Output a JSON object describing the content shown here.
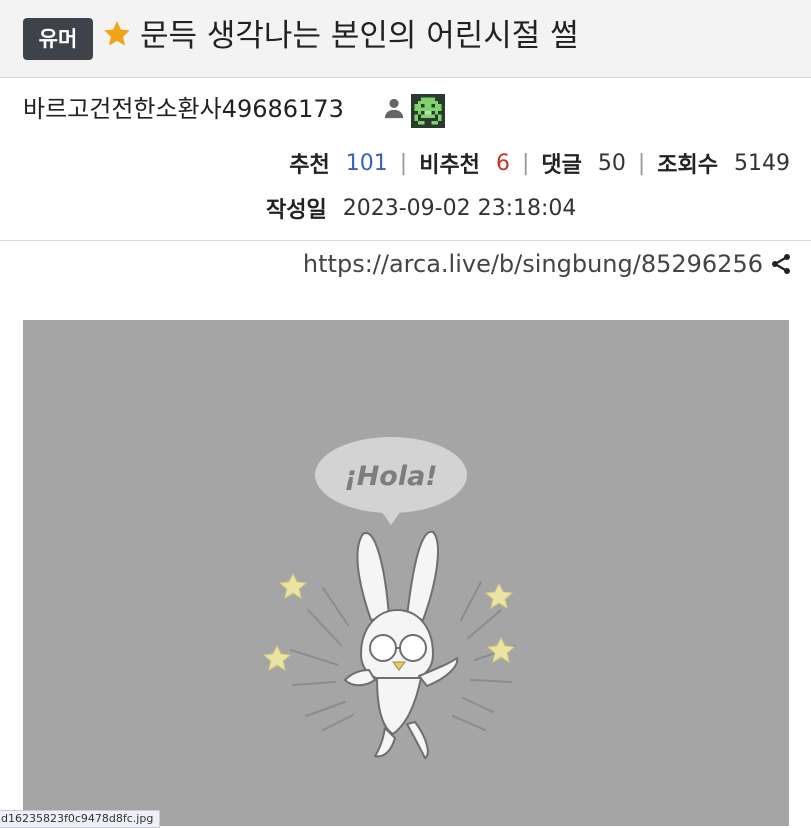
{
  "post": {
    "category_badge": "유머",
    "title": "문득 생각나는 본인의 어린시절 썰",
    "star_icon": "star-icon",
    "accent_color": "#f0a417"
  },
  "author": {
    "name": "바르고건전한소환사49686173",
    "icons": [
      "user-icon",
      "pixel-avatar-icon"
    ]
  },
  "stats": {
    "recommend_label": "추천",
    "recommend_value": "101",
    "downvote_label": "비추천",
    "downvote_value": "6",
    "comments_label": "댓글",
    "comments_value": "50",
    "views_label": "조회수",
    "views_value": "5149",
    "recommend_color": "#3a63b8",
    "downvote_color": "#c0392b"
  },
  "date": {
    "label": "작성일",
    "value": "2023-09-02 23:18:04"
  },
  "link": {
    "url": "https://arca.live/b/singbung/85296256",
    "share_icon": "share-icon"
  },
  "image": {
    "speech_text": "¡Hola!",
    "background_color": "#a5a5a5"
  },
  "status_bar": {
    "text": "d16235823f0c9478d8fc.jpg"
  }
}
